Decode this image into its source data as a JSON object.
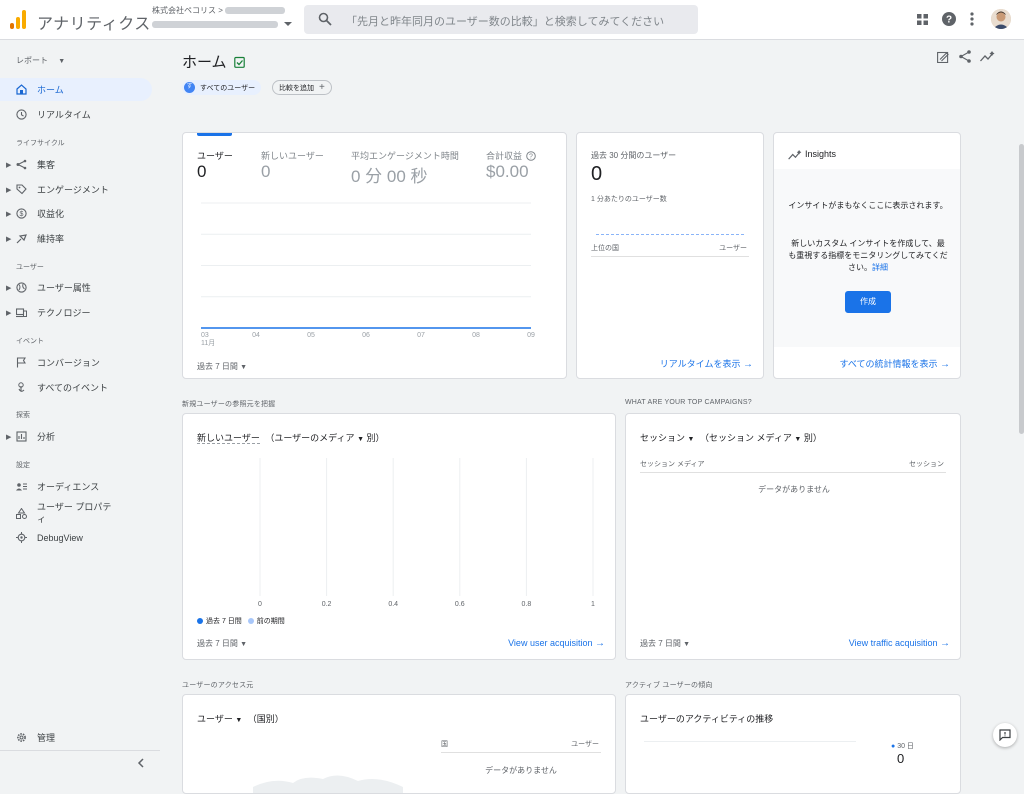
{
  "header": {
    "app_name": "アナリティクス",
    "account_label": "株式会社ペコリス",
    "account_sep": ">",
    "search_placeholder": "「先月と昨年同月のユーザー数の比較」と検索してみてください"
  },
  "sidebar": {
    "reports_label": "レポート",
    "items_top": [
      {
        "label": "ホーム",
        "icon": "home-icon",
        "active": true
      },
      {
        "label": "リアルタイム",
        "icon": "clock-icon"
      }
    ],
    "section_lifecycle": "ライフサイクル",
    "lifecycle": [
      {
        "label": "集客"
      },
      {
        "label": "エンゲージメント"
      },
      {
        "label": "収益化"
      },
      {
        "label": "維持率"
      }
    ],
    "section_user": "ユーザー",
    "user": [
      {
        "label": "ユーザー属性"
      },
      {
        "label": "テクノロジー"
      }
    ],
    "section_event": "イベント",
    "event": [
      {
        "label": "コンバージョン"
      },
      {
        "label": "すべてのイベント"
      }
    ],
    "section_explore": "探索",
    "explore": [
      {
        "label": "分析"
      }
    ],
    "section_config": "設定",
    "config": [
      {
        "label": "オーディエンス"
      },
      {
        "label": "ユーザー プロパティ"
      },
      {
        "label": "DebugView"
      }
    ],
    "admin_label": "管理"
  },
  "page": {
    "title": "ホーム",
    "chip_all_users": "すべてのユーザー",
    "chip_all_users_initial": "す",
    "chip_add_compare": "比較を追加"
  },
  "overview": {
    "metrics": [
      {
        "label": "ユーザー",
        "value": "0"
      },
      {
        "label": "新しいユーザー",
        "value": "0"
      },
      {
        "label": "平均エンゲージメント時間",
        "value": "0 分 00 秒"
      },
      {
        "label": "合計収益",
        "value": "$0.00"
      }
    ],
    "x_ticks": [
      "03",
      "04",
      "05",
      "06",
      "07",
      "08",
      "09"
    ],
    "x_month": "11月",
    "date_range": "過去 7 日間"
  },
  "chart_data": {
    "type": "line",
    "categories": [
      "03",
      "04",
      "05",
      "06",
      "07",
      "08",
      "09"
    ],
    "series": [
      {
        "values": [
          0,
          0,
          0,
          0,
          0,
          0,
          0
        ]
      }
    ],
    "xlabel": "",
    "ylabel": "",
    "grid": true
  },
  "realtime": {
    "title": "過去 30 分間のユーザー",
    "value": "0",
    "per_minute": "1 分あたりのユーザー数",
    "col_country": "上位の国",
    "col_users": "ユーザー",
    "link": "リアルタイムを表示"
  },
  "insights": {
    "title": "Insights",
    "msg1": "インサイトがまもなくここに表示されます。",
    "msg2": "新しいカスタム インサイトを作成して、最も重視する指標をモニタリングしてみてください。",
    "detail_link": "詳細",
    "create_button": "作成",
    "link": "すべての統計情報を表示"
  },
  "acquisition": {
    "section": "新規ユーザーの参照元を把握",
    "dropdown_metric": "新しいユーザー",
    "dropdown_dim": "（ユーザーのメディア",
    "dim_suffix": "別）",
    "x_ticks": [
      "0",
      "0.2",
      "0.4",
      "0.6",
      "0.8",
      "1"
    ],
    "legend_current": "過去 7 日間",
    "legend_prev": "前の期間",
    "date_range": "過去 7 日間",
    "link": "View user acquisition",
    "color_current": "#1a73e8",
    "color_prev": "#a8c7fa"
  },
  "campaigns": {
    "section": "WHAT ARE YOUR TOP CAMPAIGNS?",
    "dropdown_metric": "セッション",
    "dropdown_dim": "（セッション メディア",
    "dim_suffix": "別）",
    "col_left": "セッション メディア",
    "col_right": "セッション",
    "empty": "データがありません",
    "date_range": "過去 7 日間",
    "link": "View traffic acquisition"
  },
  "access": {
    "section": "ユーザーのアクセス元",
    "dropdown_metric": "ユーザー",
    "dim": "（国別）",
    "col_country": "国",
    "col_users": "ユーザー",
    "empty": "データがありません"
  },
  "activity": {
    "section": "アクティブ ユーザーの傾向",
    "title": "ユーザーのアクティビティの推移",
    "legend_30": "30 日",
    "value": "0"
  }
}
